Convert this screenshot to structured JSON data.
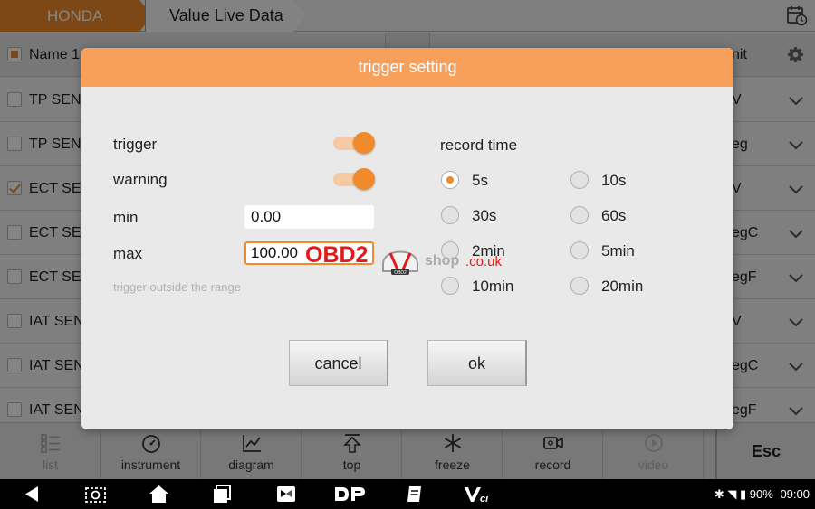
{
  "header": {
    "make_tab": "HONDA",
    "current_tab": "Value Live Data"
  },
  "table": {
    "name_header": "Name",
    "name_header_suffix": "1",
    "unit_header": "nit",
    "rows": [
      {
        "name": "TP SENS",
        "unit": "V",
        "checked": false
      },
      {
        "name": "TP SENS",
        "unit": "eg",
        "checked": false
      },
      {
        "name": "ECT SEN",
        "unit": "V",
        "checked": true
      },
      {
        "name": "ECT SEN",
        "unit": "egC",
        "checked": false
      },
      {
        "name": "ECT SEN",
        "unit": "egF",
        "checked": false
      },
      {
        "name": "IAT SEN",
        "unit": "V",
        "checked": false
      },
      {
        "name": "IAT SEN",
        "unit": "egC",
        "checked": false
      },
      {
        "name": "IAT SEN",
        "unit": "egF",
        "checked": false
      }
    ]
  },
  "toolbar": {
    "list": "list",
    "instrument": "instrument",
    "diagram": "diagram",
    "top": "top",
    "freeze": "freeze",
    "record": "record",
    "video": "video",
    "esc": "Esc"
  },
  "status_bar": {
    "battery": "90%",
    "time": "09:00"
  },
  "dialog": {
    "title": "trigger setting",
    "trigger_label": "trigger",
    "trigger_on": true,
    "warning_label": "warning",
    "warning_on": true,
    "min_label": "min",
    "min_value": "0.00",
    "max_label": "max",
    "max_value": "100.00",
    "hint": "trigger outside the range",
    "record_time_label": "record time",
    "record_options": [
      "5s",
      "10s",
      "30s",
      "60s",
      "2min",
      "5min",
      "10min",
      "20min"
    ],
    "record_selected": "5s",
    "cancel": "cancel",
    "ok": "ok"
  },
  "watermark": {
    "brand": "OBD2",
    "shop": "shop",
    "domain": ".co.uk",
    "badge": "OBD2"
  },
  "colors": {
    "accent": "#f08a2b",
    "dialog_title_bg": "#f8a05a",
    "watermark_red": "#e21a1a"
  }
}
